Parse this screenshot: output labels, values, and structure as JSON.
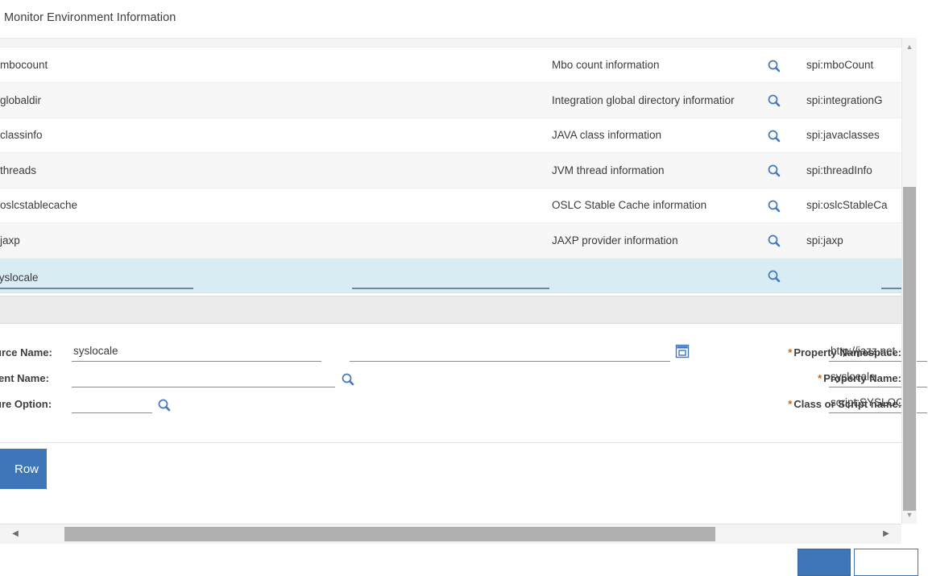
{
  "dialog": {
    "title": "Monitor Environment Information"
  },
  "table": {
    "rows": [
      {
        "name": "mbocount",
        "description": "Mbo count information",
        "icon": "search-icon",
        "spi": "spi:mboCount"
      },
      {
        "name": "globaldir",
        "description": "Integration global directory informatior",
        "icon": "search-icon",
        "spi": "spi:integrationG"
      },
      {
        "name": "classinfo",
        "description": "JAVA class information",
        "icon": "search-icon",
        "spi": "spi:javaclasses"
      },
      {
        "name": "threads",
        "description": "JVM thread information",
        "icon": "search-icon",
        "spi": "spi:threadInfo"
      },
      {
        "name": "oslcstablecache",
        "description": "OSLC Stable Cache information",
        "icon": "search-icon",
        "spi": "spi:oslcStableCa"
      },
      {
        "name": "jaxp",
        "description": "JAXP provider information",
        "icon": "search-icon",
        "spi": "spi:jaxp"
      }
    ],
    "selected_row": {
      "name": "syslocale",
      "description": "",
      "spi": "",
      "icon": "search-icon"
    }
  },
  "form": {
    "left": {
      "resource_name_label": "urce Name:",
      "resource_name_value": "syslocale",
      "resource_name_value2": "",
      "detail_icon": "select-value-icon",
      "parent_name_label": "rent Name:",
      "parent_name_value": "",
      "parent_lookup_icon": "search-icon",
      "feature_option_label": "ure Option:",
      "feature_option_value": "",
      "feature_lookup_icon": "search-icon"
    },
    "right": {
      "property_namespace_label": "Property Namespace:",
      "property_namespace_value": "http://jazz.net",
      "property_name_label": "Property Name:",
      "property_name_value": "syslocale",
      "class_or_script_label": "Class or Script name:",
      "class_or_script_value": "script:SYSLOC",
      "required_marker": "*"
    }
  },
  "actions": {
    "new_row_label": "Row"
  },
  "scrollbars": {
    "horizontal": {
      "left_arrow": "◀",
      "right_arrow": "▶"
    },
    "vertical": {
      "up_arrow": "▲",
      "down_arrow": "▼"
    }
  },
  "dialog_buttons": {
    "primary_label": "",
    "secondary_label": ""
  },
  "colors": {
    "accent": "#3f76b8",
    "selected_row": "#d7ecf3",
    "alt_row": "#f7f7f7",
    "required": "#d4600a",
    "icon_blue": "#4178be"
  }
}
